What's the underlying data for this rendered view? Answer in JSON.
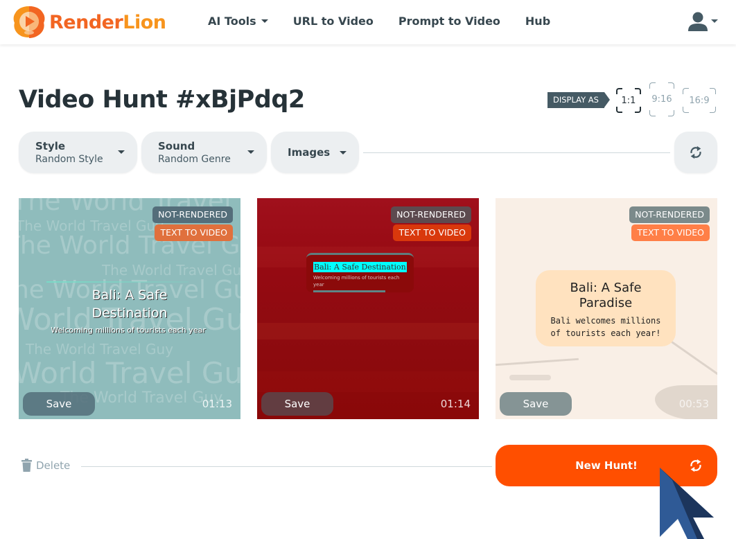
{
  "brand": {
    "name_part1": "Render",
    "name_part2": "Lion"
  },
  "nav": {
    "items": [
      {
        "label": "AI Tools",
        "has_dropdown": true
      },
      {
        "label": "URL to Video",
        "has_dropdown": false
      },
      {
        "label": "Prompt to Video",
        "has_dropdown": false
      },
      {
        "label": "Hub",
        "has_dropdown": false
      }
    ],
    "user_icon": "user-icon"
  },
  "page": {
    "title": "Video Hunt #xBjPdq2",
    "display_as_label": "DISPLAY AS",
    "ratios": [
      {
        "label": "1:1",
        "active": true
      },
      {
        "label": "9:16",
        "active": false
      },
      {
        "label": "16:9",
        "active": false
      }
    ]
  },
  "filters": {
    "style": {
      "label": "Style",
      "value": "Random Style"
    },
    "sound": {
      "label": "Sound",
      "value": "Random Genre"
    },
    "images": {
      "label": "Images"
    },
    "refresh_icon": "refresh-icon"
  },
  "cards": [
    {
      "status": "NOT-RENDERED",
      "type": "TEXT TO VIDEO",
      "headline": "Bali: A Safe Destination",
      "subtitle": "Welcoming millions of tourists each year",
      "watermark": "The World Travel Guy",
      "watermark_large": "World Travel Guy",
      "save_label": "Save",
      "duration": "01:13"
    },
    {
      "status": "NOT-RENDERED",
      "type": "TEXT TO VIDEO",
      "headline": "Bali: A Safe Destination",
      "subtitle": "Welcoming millions of tourists each year",
      "save_label": "Save",
      "duration": "01:14"
    },
    {
      "status": "NOT-RENDERED",
      "type": "TEXT TO VIDEO",
      "headline": "Bali: A Safe Paradise",
      "subtitle": "Bali welcomes millions of tourists each year!",
      "save_label": "Save",
      "duration": "00:53"
    }
  ],
  "footer": {
    "delete_label": "Delete",
    "new_hunt_label": "New Hunt!"
  },
  "colors": {
    "accent": "#ff4f00",
    "brand_orange": "#f26522",
    "text_dark": "#263238",
    "badge_dark": "#546e7a"
  }
}
